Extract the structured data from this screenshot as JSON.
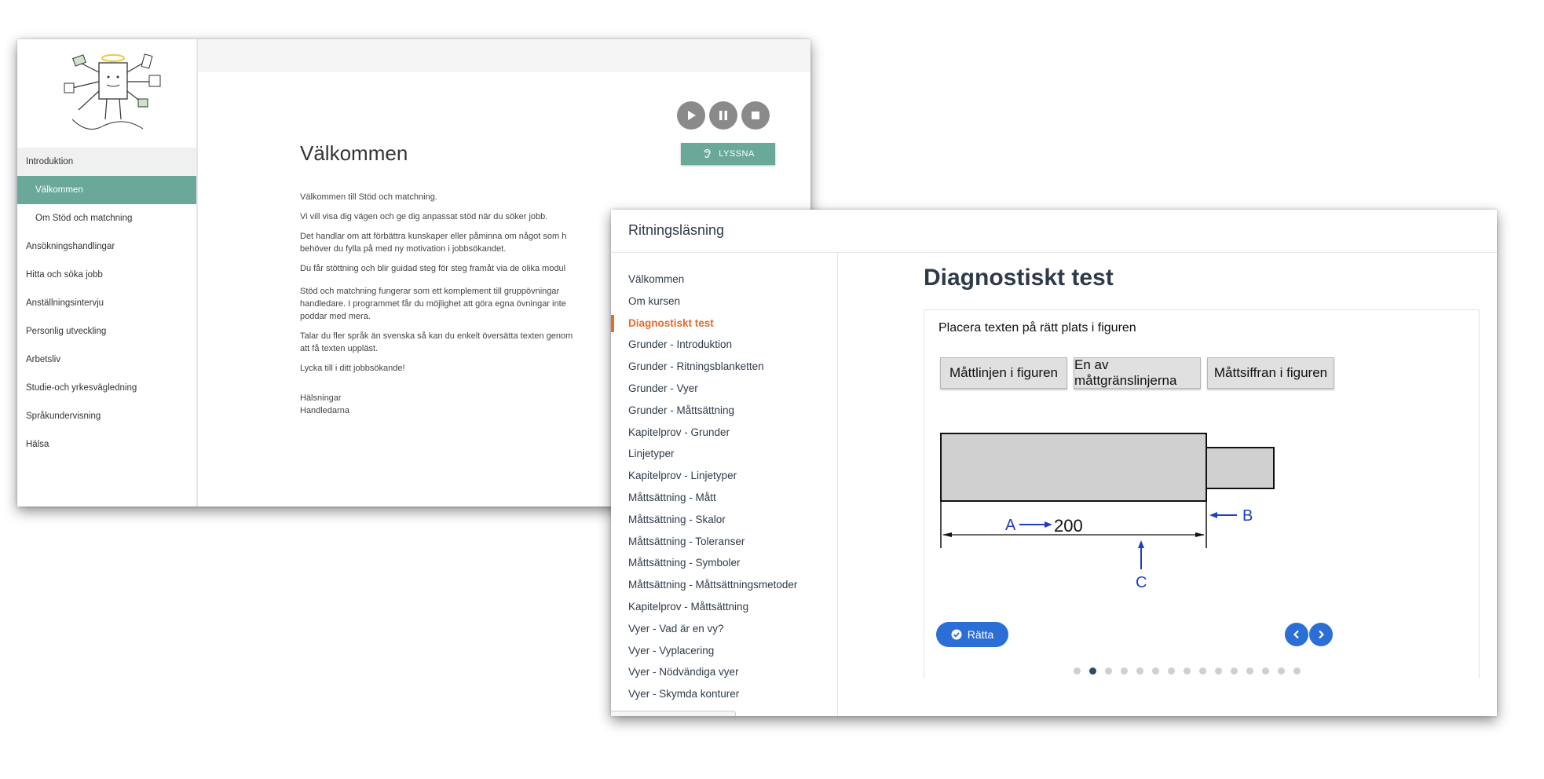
{
  "window1": {
    "sidebar": {
      "items": [
        {
          "label": "Introduktion",
          "type": "section"
        },
        {
          "label": "Välkommen",
          "type": "sub-active"
        },
        {
          "label": "Om Stöd och matchning",
          "type": "sub"
        },
        {
          "label": "Ansökningshandlingar",
          "type": "item"
        },
        {
          "label": "Hitta och söka jobb",
          "type": "item"
        },
        {
          "label": "Anställningsintervju",
          "type": "item"
        },
        {
          "label": "Personlig utveckling",
          "type": "item"
        },
        {
          "label": "Arbetsliv",
          "type": "item"
        },
        {
          "label": "Studie-och yrkesvägledning",
          "type": "item"
        },
        {
          "label": "Språkundervisning",
          "type": "item"
        },
        {
          "label": "Hälsa",
          "type": "item"
        }
      ]
    },
    "controls": {
      "play_icon": "play-icon",
      "pause_icon": "pause-icon",
      "stop_icon": "stop-icon",
      "listen_label": "LYSSNA",
      "listen_icon": "ear-icon"
    },
    "title": "Välkommen",
    "paragraphs": [
      "Välkommen till Stöd och matchning.",
      "Vi vill visa dig vägen och ge dig anpassat stöd när du söker jobb.",
      "Det handlar om att förbättra kunskaper eller påminna om något som h",
      "behöver du fylla på med ny motivation i jobbsökandet.",
      "Du får stöttning och blir guidad steg för steg framåt via de olika modul",
      "Stöd och matchning fungerar som ett komplement till gruppövningar",
      "handledare. I programmet får du möjlighet att göra egna övningar inte",
      "poddar med mera.",
      "Talar du fler språk än svenska så kan du enkelt översätta texten genom",
      "att få texten uppläst.",
      "Lycka till i ditt jobbsökande!",
      "Hälsningar",
      "Handledarna"
    ],
    "accent_color": "#6aa99a"
  },
  "window2": {
    "app_title": "Ritningsläsning",
    "sidebar": {
      "items": [
        {
          "label": "Välkommen",
          "active": false
        },
        {
          "label": "Om kursen",
          "active": false
        },
        {
          "label": "Diagnostiskt test",
          "active": true
        },
        {
          "label": "Grunder - Introduktion",
          "active": false
        },
        {
          "label": "Grunder - Ritningsblanketten",
          "active": false
        },
        {
          "label": "Grunder - Vyer",
          "active": false
        },
        {
          "label": "Grunder - Måttsättning",
          "active": false
        },
        {
          "label": "Kapitelprov - Grunder",
          "active": false
        },
        {
          "label": "Linjetyper",
          "active": false
        },
        {
          "label": "Kapitelprov - Linjetyper",
          "active": false
        },
        {
          "label": "Måttsättning - Mått",
          "active": false
        },
        {
          "label": "Måttsättning - Skalor",
          "active": false
        },
        {
          "label": "Måttsättning - Toleranser",
          "active": false
        },
        {
          "label": "Måttsättning - Symboler",
          "active": false
        },
        {
          "label": "Måttsättning - Måttsättningsmetoder",
          "active": false
        },
        {
          "label": "Kapitelprov - Måttsättning",
          "active": false
        },
        {
          "label": "Vyer - Vad är en vy?",
          "active": false
        },
        {
          "label": "Vyer - Vyplacering",
          "active": false
        },
        {
          "label": "Vyer - Nödvändiga vyer",
          "active": false
        },
        {
          "label": "Vyer - Skymda konturer",
          "active": false
        }
      ]
    },
    "main": {
      "title": "Diagnostiskt test",
      "instruction": "Placera texten på rätt plats i figuren",
      "options": [
        "Måttlinjen i figuren",
        "En av måttgränslinjerna",
        "Måttsiffran i figuren"
      ],
      "figure": {
        "labels": {
          "a": "A",
          "b": "B",
          "c": "C",
          "dimension": "200"
        }
      },
      "check_label": "Rätta",
      "check_icon": "check-circle-icon",
      "prev_icon": "chevron-left-icon",
      "next_icon": "chevron-right-icon",
      "pagination": {
        "total": 15,
        "current": 2
      }
    },
    "active_color": "#e8692a",
    "button_color": "#2b6fd6"
  }
}
